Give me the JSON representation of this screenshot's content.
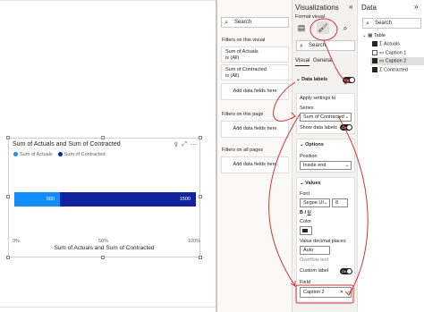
{
  "visual": {
    "title": "Sum of Actuals and Sum of Contracted",
    "legend": [
      {
        "label": "Sum of Actuals",
        "color": "#118dff"
      },
      {
        "label": "Sum of Contracted",
        "color": "#12239e"
      }
    ],
    "x_ticks": [
      "0%",
      "50%",
      "100%"
    ],
    "x_label": "Sum of Actuals and Sum of Contracted"
  },
  "chart_data": {
    "type": "bar",
    "stacked_percent": true,
    "categories": [
      ""
    ],
    "series": [
      {
        "name": "Sum of Actuals",
        "values": [
          500
        ]
      },
      {
        "name": "Sum of Contracted",
        "values": [
          1500
        ]
      }
    ],
    "data_labels": [
      "500",
      "1500"
    ],
    "title": "Sum of Actuals and Sum of Contracted",
    "xlabel": "Sum of Actuals and Sum of Contracted",
    "x_ticks": [
      "0%",
      "50%",
      "100%"
    ],
    "legend": "top-left"
  },
  "filters": {
    "search_placeholder": "Search",
    "on_visual_header": "Filters on this visual",
    "card1_line1": "Sum of Actuals",
    "card1_line2": "is (All)",
    "card2_line1": "Sum of Contracted",
    "card2_line2": "is (All)",
    "add_fields": "Add data fields here",
    "on_page_header": "Filters on this page",
    "all_pages_header": "Filters on all pages"
  },
  "viz": {
    "title": "Visualizations",
    "chevron": "»",
    "format_visual": "Format visual",
    "search_placeholder": "Search",
    "tab_visual": "Visual",
    "tab_general": "General",
    "data_labels": "Data labels",
    "data_labels_toggle": "On",
    "apply_settings": "Apply settings to",
    "series_label": "Series",
    "series_value": "Sum of Contracted",
    "show_for_series": "Show data labels",
    "show_toggle": "On",
    "options": "Options",
    "position_label": "Position",
    "position_value": "Inside end",
    "values": "Values",
    "font_label": "Font",
    "font_value": "Segoe UI",
    "font_size": "8",
    "color_label": "Color",
    "decimal_label": "Value decimal places",
    "decimal_value": "Auto",
    "overflow_label": "Overflow text",
    "custom_label": "Custom label",
    "custom_toggle": "On",
    "field_label": "Field",
    "field_value": "Caption 2",
    "accent_color": "#d13438"
  },
  "data": {
    "title": "Data",
    "chevron": "»",
    "search_placeholder": "Search",
    "table_name": "Table",
    "fields": [
      {
        "label": "Actuals",
        "checked": true
      },
      {
        "label": "Caption 1",
        "checked": false
      },
      {
        "label": "Caption 2",
        "checked": true
      },
      {
        "label": "Contracted",
        "checked": true
      }
    ]
  }
}
